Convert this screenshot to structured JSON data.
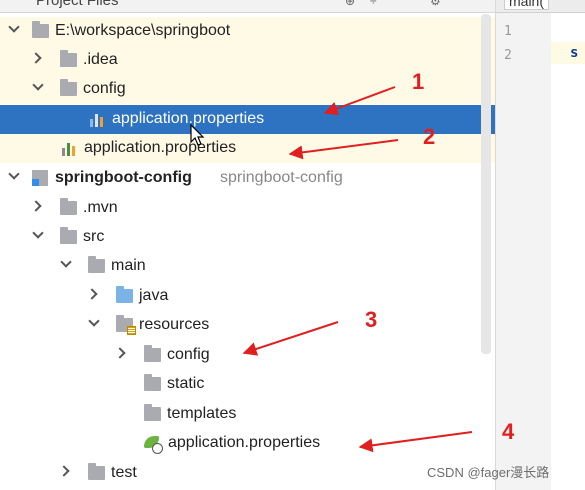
{
  "panel": {
    "title": "Project Files"
  },
  "tree": {
    "root_path": "E:\\workspace\\springboot",
    "idea": ".idea",
    "config": "config",
    "config_props": "application.properties",
    "root_props": "application.properties",
    "module_name": "springboot-config",
    "module_path": "springboot-config",
    "mvn": ".mvn",
    "src": "src",
    "main": "main",
    "java": "java",
    "resources": "resources",
    "res_config": "config",
    "static": "static",
    "templates": "templates",
    "res_props": "application.properties",
    "test": "test"
  },
  "editor": {
    "tab": "main(",
    "line_numbers": [
      "1",
      "2"
    ],
    "code_fragment": "s"
  },
  "annotations": [
    "1",
    "2",
    "3",
    "4"
  ],
  "watermark": "CSDN @fager漫长路",
  "colors": {
    "selection": "#2e73c1",
    "highlight": "#fffae6",
    "annotation": "#e02020"
  }
}
